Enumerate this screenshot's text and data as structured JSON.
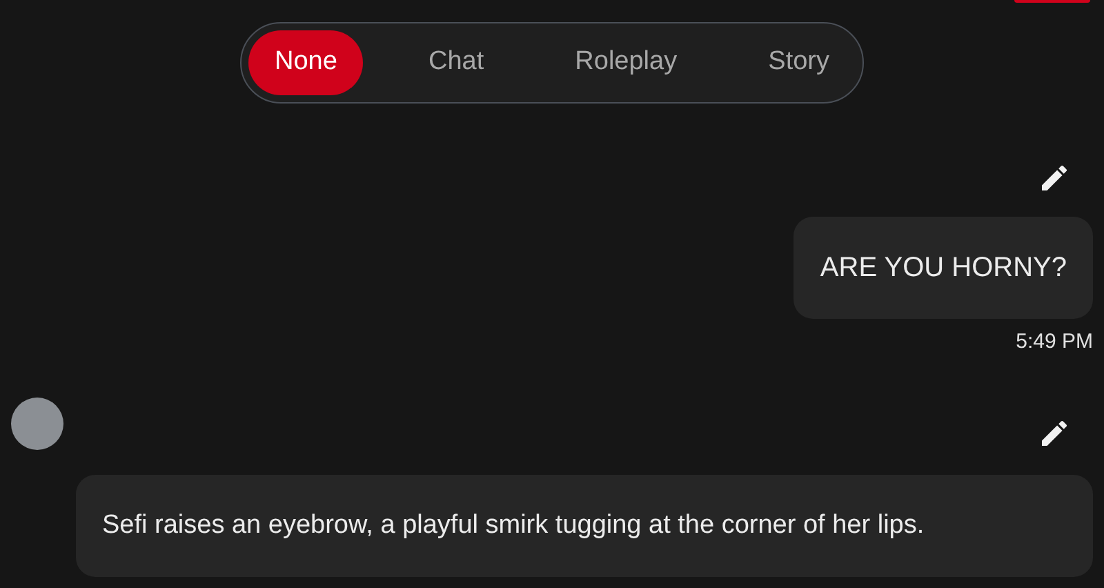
{
  "modes": [
    {
      "label": "None",
      "selected": true
    },
    {
      "label": "Chat",
      "selected": false
    },
    {
      "label": "Roleplay",
      "selected": false
    },
    {
      "label": "Story",
      "selected": false
    }
  ],
  "messages": [
    {
      "kind": "user",
      "text": "ARE YOU HORNY?",
      "time": "5:49 PM"
    },
    {
      "kind": "bot",
      "text": "Sefi raises an eyebrow, a playful smirk tugging at the corner of her lips."
    }
  ]
}
